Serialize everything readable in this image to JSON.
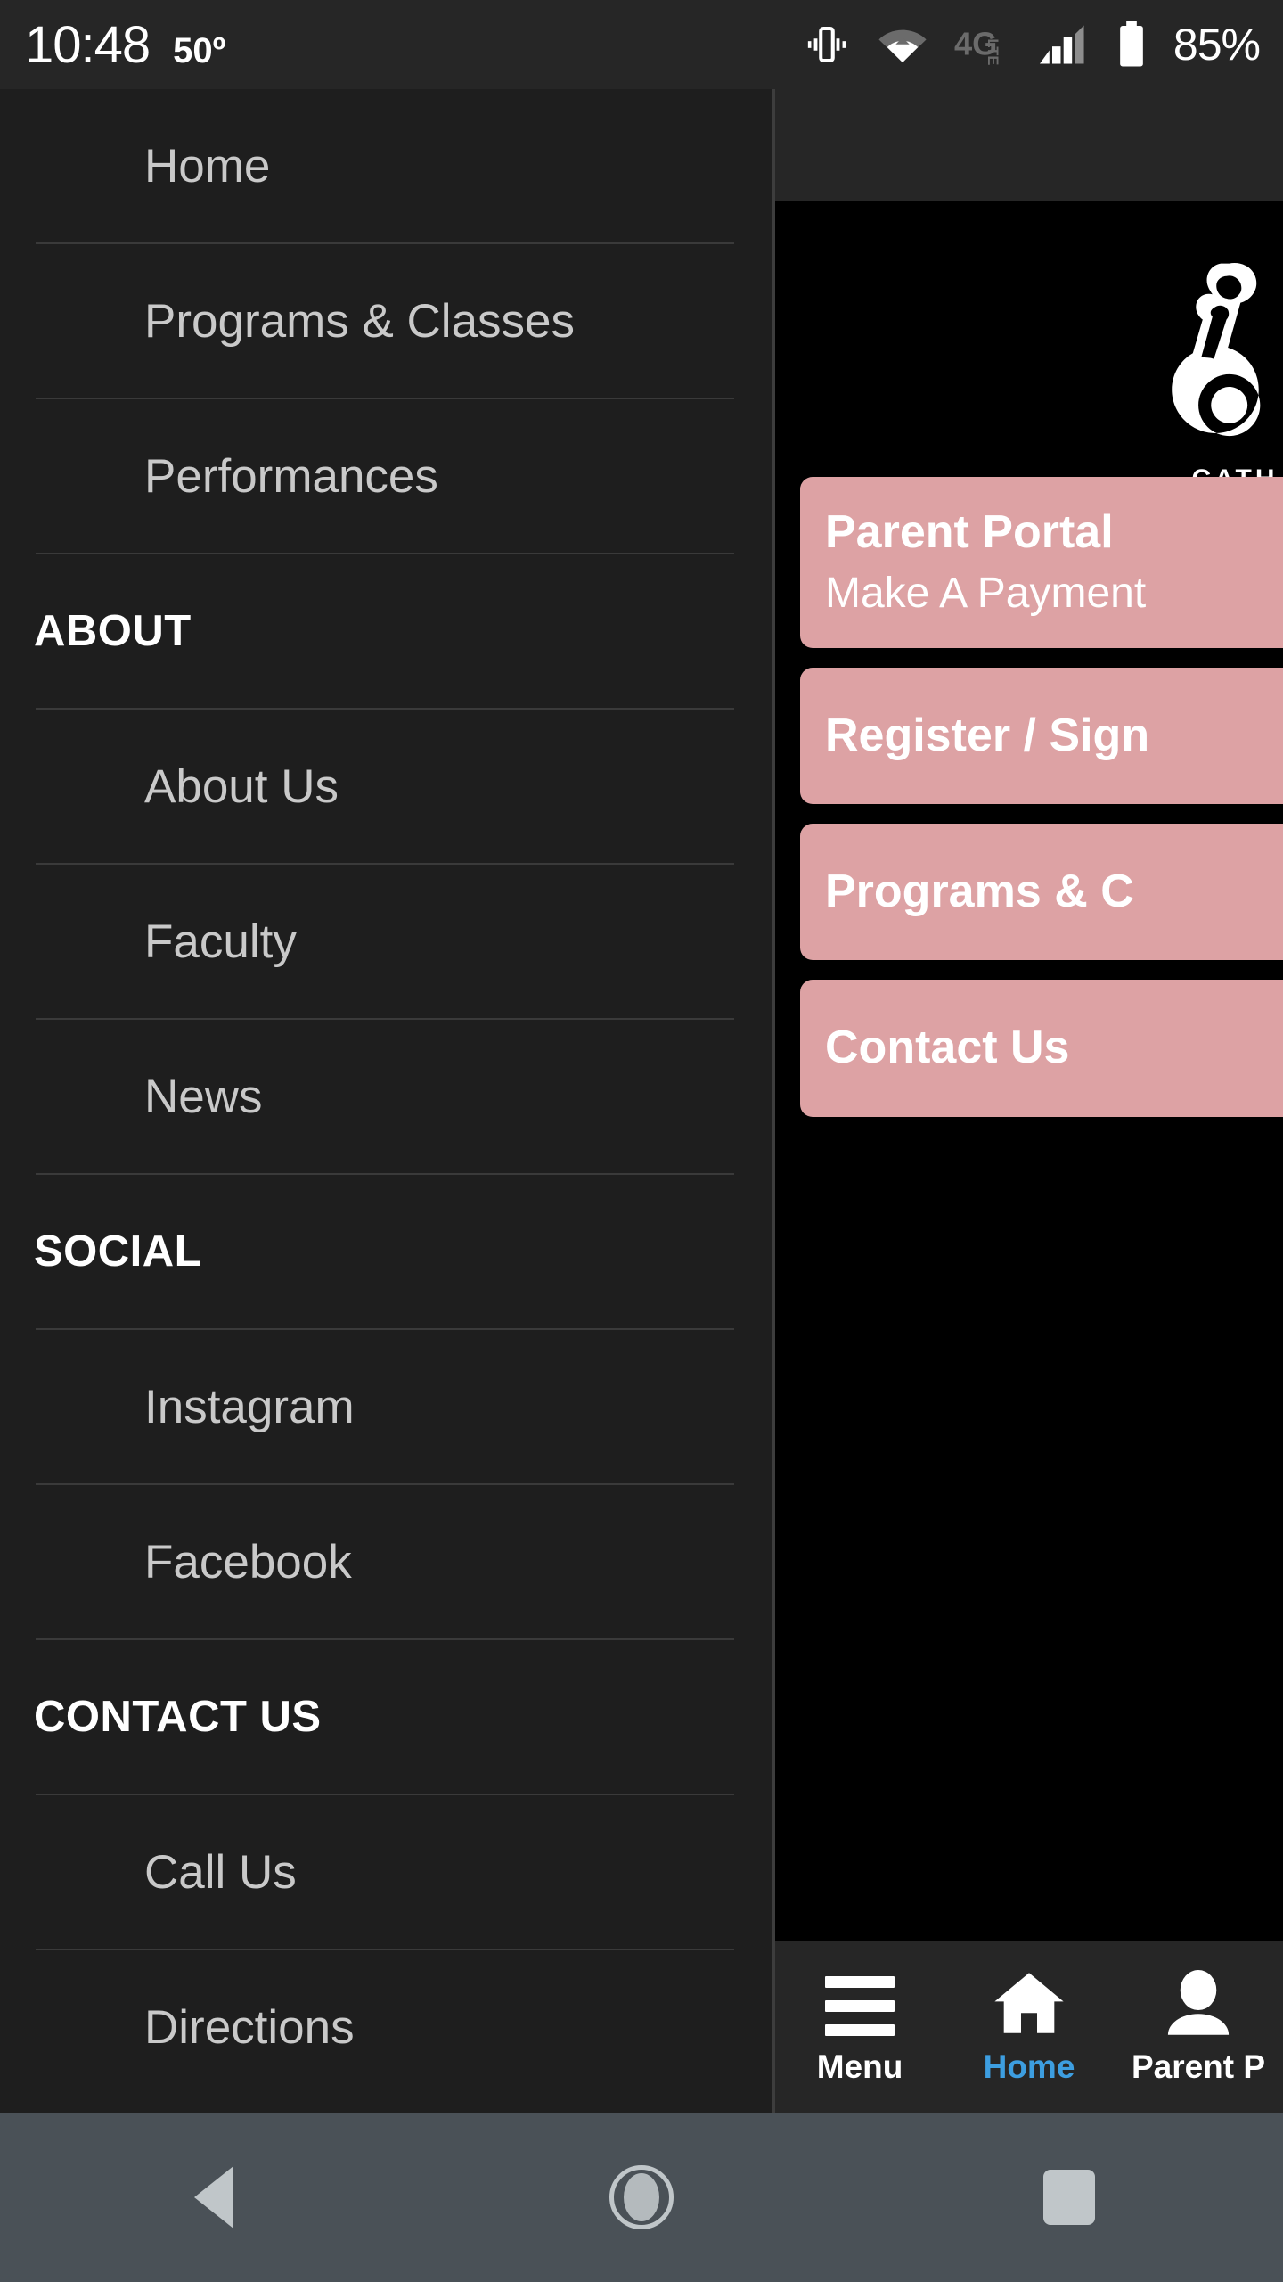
{
  "status_bar": {
    "time": "10:48",
    "temperature": "50º",
    "battery_percent": "85%",
    "icons": [
      "vibrate-icon",
      "wifi-icon",
      "4g-lte-icon",
      "signal-icon",
      "battery-icon"
    ],
    "network_label": "4G",
    "network_sub": "LTE"
  },
  "drawer": {
    "items": [
      {
        "type": "link",
        "label": "Home"
      },
      {
        "type": "link",
        "label": "Programs & Classes"
      },
      {
        "type": "link",
        "label": "Performances"
      },
      {
        "type": "header",
        "label": "ABOUT"
      },
      {
        "type": "link",
        "label": "About Us"
      },
      {
        "type": "link",
        "label": "Faculty"
      },
      {
        "type": "link",
        "label": "News"
      },
      {
        "type": "header",
        "label": "SOCIAL"
      },
      {
        "type": "link",
        "label": "Instagram"
      },
      {
        "type": "link",
        "label": "Facebook"
      },
      {
        "type": "header",
        "label": "CONTACT US"
      },
      {
        "type": "link",
        "label": "Call Us"
      },
      {
        "type": "link",
        "label": "Directions"
      }
    ]
  },
  "app": {
    "logo": {
      "word": "CATH",
      "icon": "dancer-silhouette-icon"
    },
    "buttons": [
      {
        "title": "Parent Portal",
        "subtitle": "Make A Payment"
      },
      {
        "title": "Register / Sign"
      },
      {
        "title": "Programs & C"
      },
      {
        "title": "Contact Us"
      }
    ]
  },
  "bottom_nav": {
    "items": [
      {
        "label": "Menu",
        "icon": "hamburger-icon",
        "active": false
      },
      {
        "label": "Home",
        "icon": "house-icon",
        "active": true
      },
      {
        "label": "Parent P",
        "icon": "person-icon",
        "active": false
      }
    ]
  },
  "system_nav": {
    "back": "back-triangle-icon",
    "home": "home-circle-icon",
    "recents": "recents-square-icon"
  },
  "colors": {
    "accent_pink": "#dda2a4",
    "active_blue": "#3d9ee0",
    "drawer_bg": "#1e1e1e",
    "chrome_bg": "#262626",
    "system_nav_bg": "#4a5157"
  }
}
